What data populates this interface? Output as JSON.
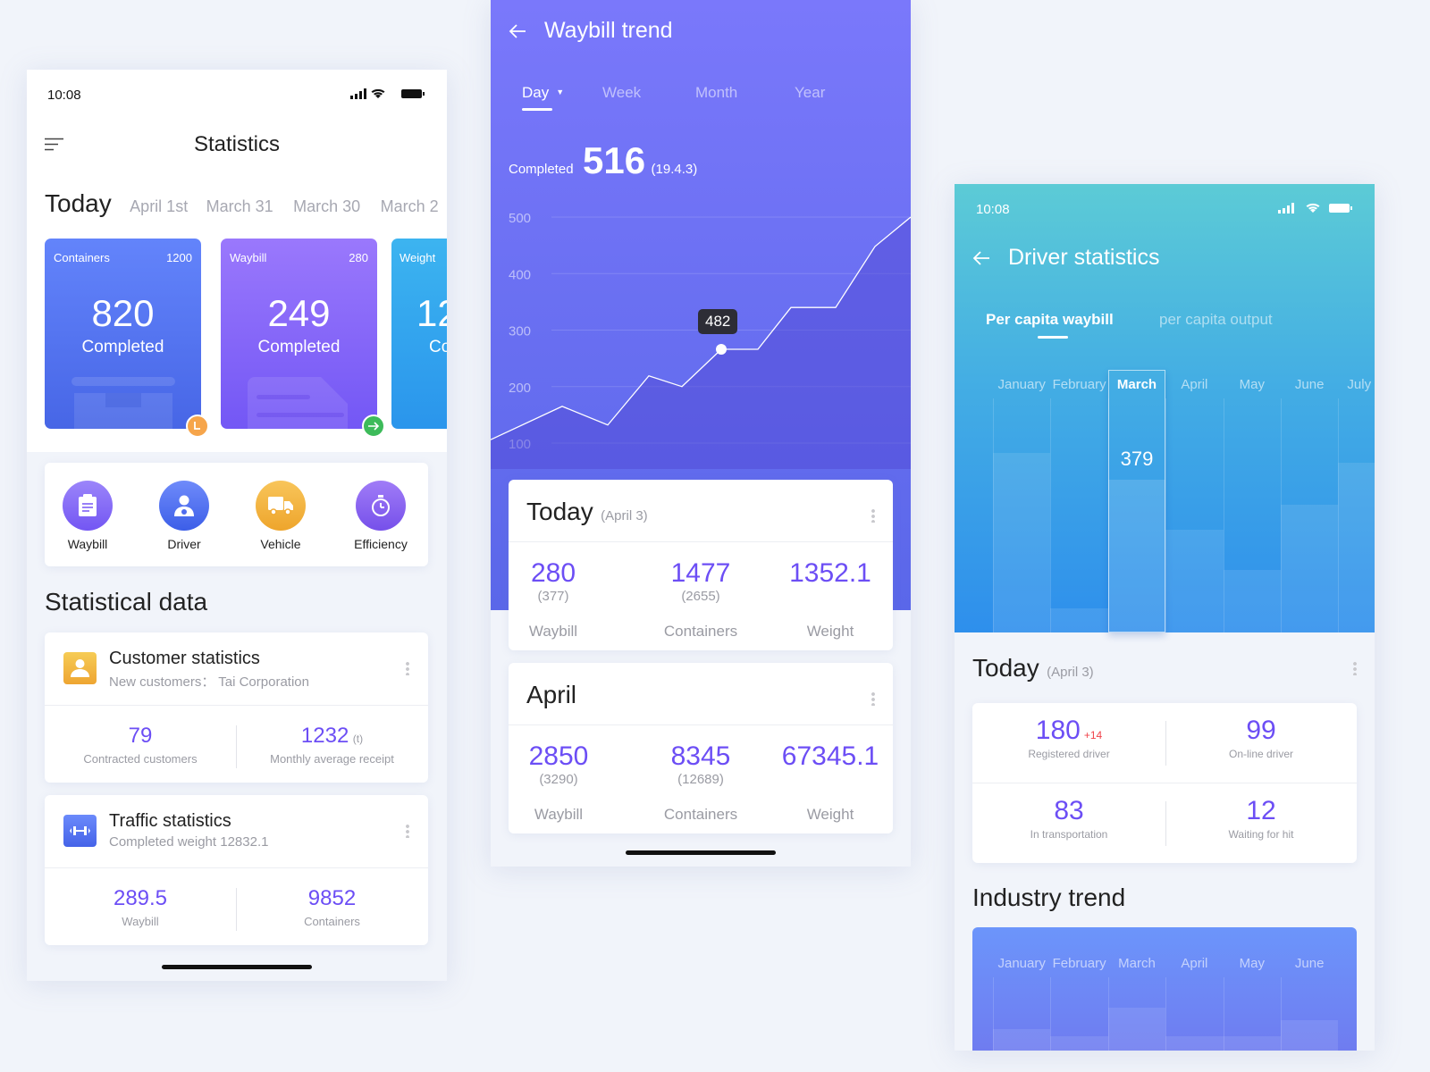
{
  "colors": {
    "accent": "#6c4ef5",
    "purple_top": "#7a78fb",
    "purple_bottom": "#5d6ae8",
    "teal_top": "#5bcbd6",
    "blue_bottom": "#2e8fec",
    "plus_red": "#f0424a"
  },
  "stats_screen": {
    "status_time": "10:08",
    "title": "Statistics",
    "menu_icon": "hamburger-menu-icon",
    "date_tabs": [
      "Today",
      "April 1st",
      "March 31",
      "March 30",
      "March 2"
    ],
    "summary_cards": [
      {
        "label": "Containers",
        "total": "1200",
        "value": "820",
        "caption": "Completed",
        "badge_icon": "clock-icon",
        "badge_color": "#f6a54b"
      },
      {
        "label": "Waybill",
        "total": "280",
        "value": "249",
        "caption": "Completed",
        "badge_icon": "arrow-right-icon",
        "badge_color": "#3dbb5a"
      },
      {
        "label": "Weight",
        "total": "",
        "value": "12",
        "caption": "Co"
      }
    ],
    "shortcuts": [
      {
        "label": "Waybill",
        "icon": "clipboard-icon",
        "color": "#7d63f5"
      },
      {
        "label": "Driver",
        "icon": "driver-icon",
        "color": "#4d6ef0"
      },
      {
        "label": "Vehicle",
        "icon": "truck-icon",
        "color": "#f2b23c"
      },
      {
        "label": "Efficiency",
        "icon": "stopwatch-icon",
        "color": "#8a5cf0"
      }
    ],
    "section_title": "Statistical data",
    "customer": {
      "title": "Customer statistics",
      "subtitle": "New customers： Tai Corporation",
      "left_value": "79",
      "left_label": "Contracted customers",
      "right_value": "1232",
      "right_unit": "(t)",
      "right_label": "Monthly average receipt"
    },
    "traffic": {
      "title": "Traffic statistics",
      "subtitle": "Completed weight 12832.1",
      "left_value": "289.5",
      "left_label": "Waybill",
      "right_value": "9852",
      "right_label": "Containers"
    }
  },
  "trend_screen": {
    "title": "Waybill trend",
    "tabs": [
      "Day",
      "Week",
      "Month",
      "Year"
    ],
    "active_tab": "Day",
    "completed_label": "Completed",
    "completed_value": "516",
    "completed_date": "(19.4.3)",
    "tooltip": "482",
    "today": {
      "title": "Today",
      "date": "(April 3)",
      "items": [
        {
          "value": "280",
          "sub": "(377)",
          "label": "Waybill"
        },
        {
          "value": "1477",
          "sub": "(2655)",
          "label": "Containers"
        },
        {
          "value": "1352.1",
          "sub": "",
          "label": "Weight"
        }
      ]
    },
    "april": {
      "title": "April",
      "items": [
        {
          "value": "2850",
          "sub": "(3290)",
          "label": "Waybill"
        },
        {
          "value": "8345",
          "sub": "(12689)",
          "label": "Containers"
        },
        {
          "value": "67345.1",
          "sub": "",
          "label": "Weight"
        }
      ]
    }
  },
  "driver_screen": {
    "status_time": "10:08",
    "title": "Driver statistics",
    "tabs": [
      "Per capita waybill",
      "per capita output"
    ],
    "active_tab": "Per capita waybill",
    "today_title": "Today",
    "today_date": "(April 3)",
    "stats": [
      {
        "value": "180",
        "delta": "+14",
        "label": "Registered driver"
      },
      {
        "value": "99",
        "label": "On-line driver"
      },
      {
        "value": "83",
        "label": "In transportation"
      },
      {
        "value": "12",
        "label": "Waiting for hit"
      }
    ],
    "industry_title": "Industry trend"
  },
  "chart_data": [
    {
      "type": "area",
      "title": "Waybill trend",
      "ylim": [
        100,
        500
      ],
      "yticks": [
        "500",
        "400",
        "300",
        "200",
        "100"
      ],
      "grid": true,
      "values": [
        106,
        165,
        132,
        219,
        200,
        266,
        266,
        340,
        340,
        448,
        500
      ],
      "highlight_index": 5,
      "highlight_label": "482"
    },
    {
      "type": "bar",
      "categories": [
        "January",
        "February",
        "March",
        "April",
        "May",
        "June",
        "July"
      ],
      "values": [
        447,
        61,
        379,
        255,
        156,
        318,
        422
      ],
      "selected": "March",
      "selected_label": "379"
    },
    {
      "type": "bar",
      "categories": [
        "January",
        "February",
        "March",
        "April",
        "May",
        "June"
      ],
      "values": [
        60,
        40,
        120,
        40,
        40,
        85
      ]
    }
  ]
}
